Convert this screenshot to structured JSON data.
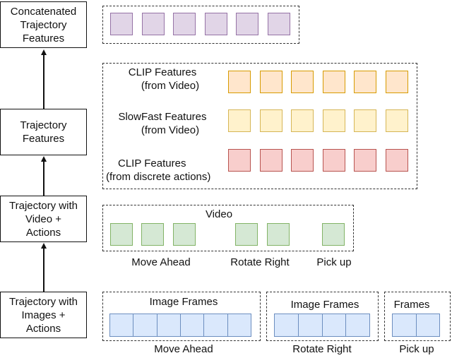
{
  "stages": {
    "concatenated": [
      "Concatenated",
      "Trajectory",
      "Features"
    ],
    "features": [
      "Trajectory",
      "Features"
    ],
    "video_actions": [
      "Trajectory with",
      "Video +",
      "Actions"
    ],
    "images_actions": [
      "Trajectory with",
      "Images +",
      "Actions"
    ]
  },
  "feature_rows": [
    {
      "label": [
        "CLIP Features",
        "(from Video)"
      ],
      "color": "orange",
      "count": 6
    },
    {
      "label": [
        "SlowFast Features",
        "(from Video)"
      ],
      "color": "yellow",
      "count": 6
    },
    {
      "label": [
        "CLIP Features",
        "(from discrete actions)"
      ],
      "color": "red",
      "count": 6
    }
  ],
  "concatenated_count": 6,
  "video": {
    "title": "Video",
    "actions": [
      "Move Ahead",
      "Rotate Right",
      "Pick up"
    ],
    "clips_per_action": [
      3,
      2,
      1
    ]
  },
  "image_frames": {
    "groups": [
      {
        "title": "Image Frames",
        "action": "Move Ahead",
        "frames": 6
      },
      {
        "title": "Image Frames",
        "action": "Rotate Right",
        "frames": 4
      },
      {
        "title": "Frames",
        "action": "Pick up",
        "frames": 2
      }
    ]
  },
  "colors": {
    "purple": "#e1d5e7",
    "orange": "#ffe6cc",
    "yellow": "#fff2cc",
    "red": "#f8cecc",
    "green": "#d5e8d4",
    "blue": "#dae8fc"
  }
}
